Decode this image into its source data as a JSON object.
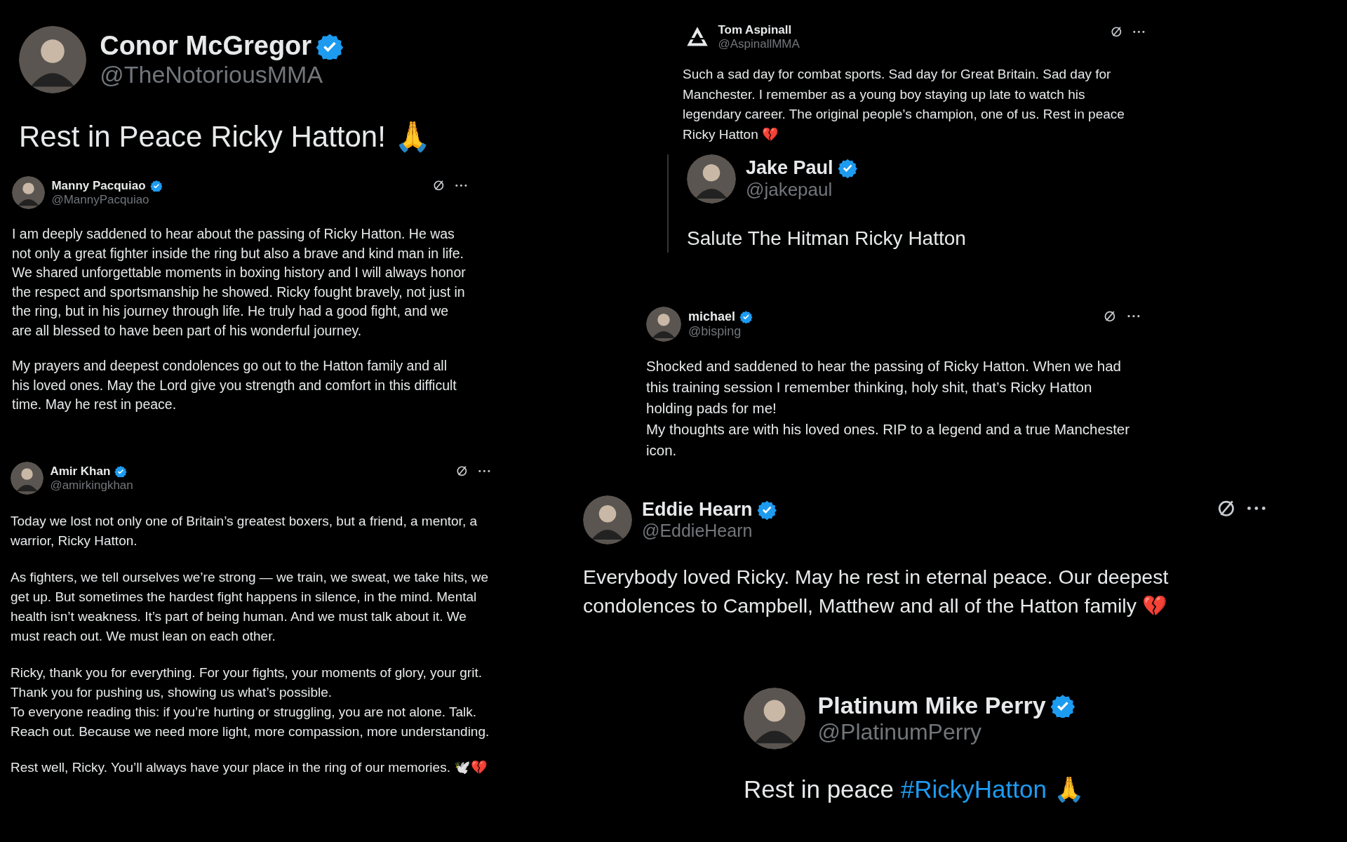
{
  "posts": [
    {
      "kind": "post",
      "name": "Conor McGregor",
      "handle": "@TheNotoriousMMA",
      "verified": true,
      "actions": false,
      "paragraphs": [
        [
          "Rest in Peace Ricky Hatton! 🙏"
        ]
      ]
    },
    {
      "kind": "post",
      "name": "Manny Pacquiao",
      "handle": "@MannyPacquiao",
      "verified": true,
      "actions": true,
      "paragraphs": [
        [
          "I am deeply saddened to hear about the passing of Ricky Hatton.  He was not only a great fighter inside the ring but also a brave and kind man in life.  We shared unforgettable moments in boxing history and I will always honor the respect and sportsmanship he showed. Ricky fought bravely, not just in the ring, but in his journey through life. He truly had a good fight, and we are all blessed to have been part of his wonderful journey."
        ],
        [
          "My prayers and deepest condolences go out to the Hatton family and all his loved ones. May the Lord give you strength and comfort in this difficult time. May he rest in peace."
        ]
      ]
    },
    {
      "kind": "post",
      "name": "Amir Khan",
      "handle": "@amirkingkhan",
      "verified": true,
      "actions": true,
      "paragraphs": [
        [
          "Today we lost not only one of Britain’s greatest boxers, but a friend, a mentor, a warrior, Ricky Hatton."
        ],
        [
          "As fighters, we tell ourselves we’re strong — we train, we sweat, we take hits, we get up. But sometimes the hardest fight happens in silence, in the mind. Mental health isn’t weakness. It’s part of being human. And we must talk about it. We must reach out. We must lean on each other."
        ],
        [
          "Ricky, thank you for everything. For your fights, your moments of glory, your grit. Thank you for pushing us, showing us what’s possible.",
          "To everyone reading this: if you’re hurting or struggling, you are not alone. Talk. Reach out. Because we need more light, more compassion, more understanding."
        ],
        [
          "Rest well, Ricky. You’ll always have your place in the ring of our memories. 🕊️💔"
        ]
      ]
    },
    {
      "kind": "post",
      "name": "Tom Aspinall",
      "handle": "@AspinallMMA",
      "verified": false,
      "actions": true,
      "paragraphs": [
        [
          "Such a sad day for combat sports. Sad day for Great Britain. Sad day for Manchester. I remember as a young boy staying up late to watch his legendary career. The original people’s champion, one of us. Rest in peace Ricky Hatton 💔"
        ]
      ]
    },
    {
      "kind": "quote",
      "name": "Jake Paul",
      "handle": "@jakepaul",
      "verified": true,
      "actions": false,
      "paragraphs": [
        [
          "Salute The Hitman Ricky Hatton"
        ]
      ]
    },
    {
      "kind": "post",
      "name": "michael",
      "handle": "@bisping",
      "verified": true,
      "actions": true,
      "paragraphs": [
        [
          "Shocked and saddened to hear the passing of Ricky Hatton. When we had this training session I remember thinking, holy shit, that’s Ricky Hatton holding pads for me!",
          "My thoughts are with his loved ones. RIP to a legend and a true Manchester icon."
        ]
      ]
    },
    {
      "kind": "post",
      "name": "Eddie Hearn",
      "handle": "@EddieHearn",
      "verified": true,
      "actions": true,
      "paragraphs": [
        [
          "Everybody loved Ricky. May he rest in eternal peace. Our deepest condolences to Campbell, Matthew and all of the Hatton family 💔"
        ]
      ]
    },
    {
      "kind": "post",
      "name": "Platinum Mike Perry",
      "handle": "@PlatinumPerry",
      "verified": true,
      "actions": false,
      "paragraphs": [
        [
          [
            {
              "kind": "text",
              "text": "Rest in peace "
            },
            {
              "kind": "hashtag",
              "text": "#RickyHatton"
            },
            {
              "kind": "text",
              "text": " 🙏"
            }
          ]
        ]
      ]
    }
  ]
}
